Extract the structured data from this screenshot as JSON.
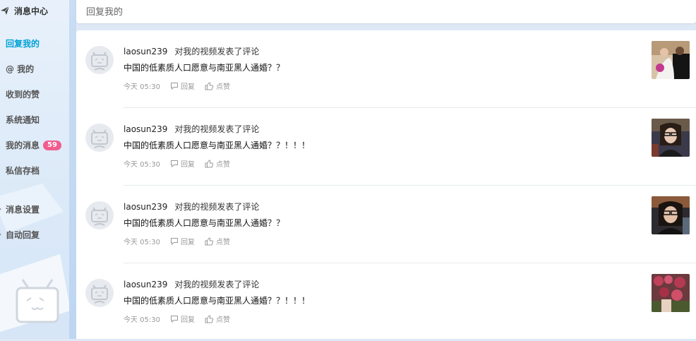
{
  "sidebar": {
    "title": "消息中心",
    "items": [
      {
        "label": "回复我的",
        "active": true
      },
      {
        "label": "@ 我的"
      },
      {
        "label": "收到的赞"
      },
      {
        "label": "系统通知"
      },
      {
        "label": "我的消息",
        "badge": "59"
      },
      {
        "label": "私信存档"
      }
    ],
    "settings": [
      {
        "label": "消息设置"
      },
      {
        "label": "自动回复"
      }
    ]
  },
  "header": {
    "title": "回复我的"
  },
  "replies": [
    {
      "user": "laosun239",
      "action": "对我的视频发表了评论",
      "content": "中国的低素质人口愿意与南亚黑人通婚？？",
      "time": "今天 05:30",
      "reply_label": "回复",
      "like_label": "点赞"
    },
    {
      "user": "laosun239",
      "action": "对我的视频发表了评论",
      "content": "中国的低素质人口愿意与南亚黑人通婚？？！！！",
      "time": "今天 05:30",
      "reply_label": "回复",
      "like_label": "点赞"
    },
    {
      "user": "laosun239",
      "action": "对我的视频发表了评论",
      "content": "中国的低素质人口愿意与南亚黑人通婚？？",
      "time": "今天 05:30",
      "reply_label": "回复",
      "like_label": "点赞"
    },
    {
      "user": "laosun239",
      "action": "对我的视频发表了评论",
      "content": "中国的低素质人口愿意与南亚黑人通婚？？！！！",
      "time": "今天 05:30",
      "reply_label": "回复",
      "like_label": "点赞"
    }
  ],
  "colors": {
    "accent": "#00a1d6",
    "badge": "#f25d8e"
  }
}
